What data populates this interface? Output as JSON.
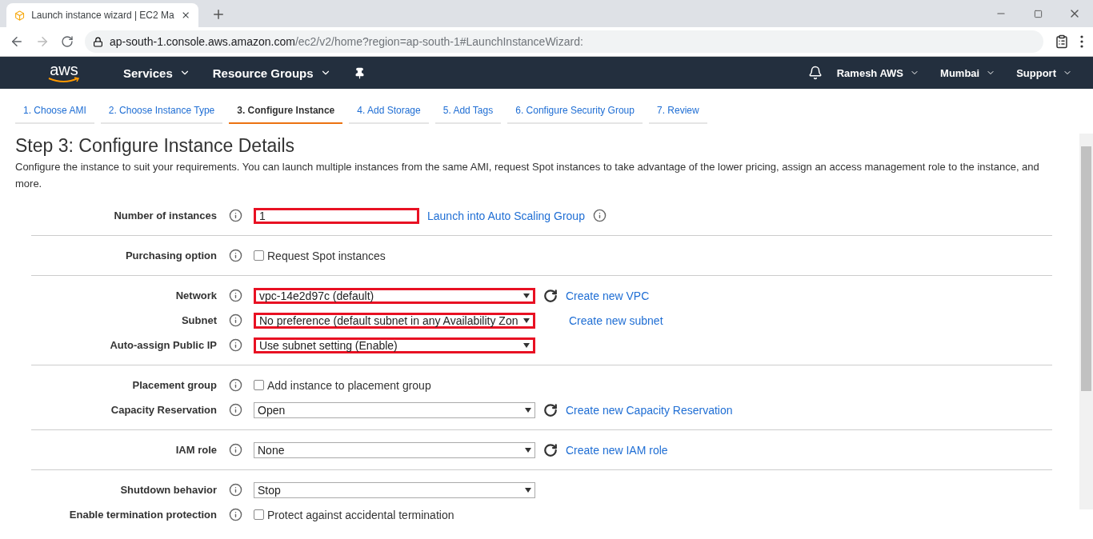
{
  "browser": {
    "tab_title": "Launch instance wizard | EC2 Ma",
    "url_host": "ap-south-1.console.aws.amazon.com",
    "url_path": "/ec2/v2/home?region=ap-south-1#LaunchInstanceWizard:"
  },
  "navbar": {
    "logo": "aws",
    "left": [
      "Services",
      "Resource Groups"
    ],
    "right": [
      "Ramesh AWS",
      "Mumbai",
      "Support"
    ]
  },
  "steps": [
    {
      "label": "1. Choose AMI",
      "selected": false
    },
    {
      "label": "2. Choose Instance Type",
      "selected": false
    },
    {
      "label": "3. Configure Instance",
      "selected": true
    },
    {
      "label": "4. Add Storage",
      "selected": false
    },
    {
      "label": "5. Add Tags",
      "selected": false
    },
    {
      "label": "6. Configure Security Group",
      "selected": false
    },
    {
      "label": "7. Review",
      "selected": false
    }
  ],
  "page": {
    "title": "Step 3: Configure Instance Details",
    "description": "Configure the instance to suit your requirements. You can launch multiple instances from the same AMI, request Spot instances to take advantage of the lower pricing, assign an access management role to the instance, and more."
  },
  "groups": [
    {
      "rows": [
        {
          "label": "Number of instances",
          "kind": "input",
          "value": "1",
          "highlighted": true,
          "link": "Launch into Auto Scaling Group",
          "link_info": true
        }
      ]
    },
    {
      "rows": [
        {
          "label": "Purchasing option",
          "kind": "checkbox",
          "value": "Request Spot instances",
          "checked": false
        }
      ]
    },
    {
      "rows": [
        {
          "label": "Network",
          "kind": "select",
          "value": "vpc-14e2d97c (default)",
          "highlighted": true,
          "refresh": true,
          "link": "Create new VPC"
        },
        {
          "label": "Subnet",
          "kind": "select",
          "value": "No preference (default subnet in any Availability Zon",
          "highlighted": true,
          "refresh": false,
          "link": "Create new subnet"
        },
        {
          "label": "Auto-assign Public IP",
          "kind": "select",
          "value": "Use subnet setting (Enable)",
          "highlighted": true
        }
      ]
    },
    {
      "rows": [
        {
          "label": "Placement group",
          "kind": "checkbox",
          "value": "Add instance to placement group",
          "checked": false
        },
        {
          "label": "Capacity Reservation",
          "kind": "select",
          "value": "Open",
          "highlighted": false,
          "refresh": true,
          "link": "Create new Capacity Reservation"
        }
      ]
    },
    {
      "rows": [
        {
          "label": "IAM role",
          "kind": "select",
          "value": "None",
          "highlighted": false,
          "refresh": true,
          "link": "Create new IAM role"
        }
      ]
    },
    {
      "rows": [
        {
          "label": "Shutdown behavior",
          "kind": "select",
          "value": "Stop",
          "highlighted": false
        },
        {
          "label": "Enable termination protection",
          "kind": "checkbox",
          "value": "Protect against accidental termination",
          "checked": false
        }
      ]
    }
  ]
}
